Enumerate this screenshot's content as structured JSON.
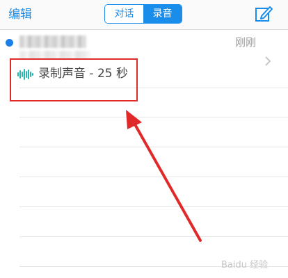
{
  "nav": {
    "edit_label": "编辑",
    "segments": [
      {
        "label": "对话",
        "active": false
      },
      {
        "label": "录音",
        "active": true
      }
    ],
    "compose_icon": "compose-icon"
  },
  "recording": {
    "time": "刚刚",
    "title": "录制声音 - 25 秒",
    "unread": true,
    "icons": [
      "waveform-icon",
      "chevron-right-icon"
    ]
  },
  "annotation": {
    "box_color": "#e02a2a",
    "arrow_color": "#e02a2a"
  },
  "watermark": "Baidu 经验",
  "colors": {
    "accent": "#1a8ce9",
    "wave": "#2bb5b0"
  }
}
